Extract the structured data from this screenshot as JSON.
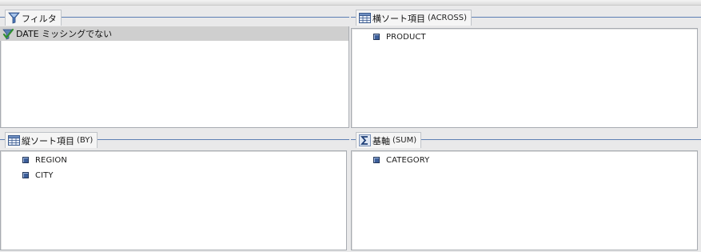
{
  "filter_panel": {
    "title": "フィルタ",
    "items": [
      {
        "label": "DATE ミッシングでない",
        "icon": "check-filter-icon"
      }
    ]
  },
  "across_panel": {
    "title": "横ソート項目",
    "subtitle": "(ACROSS)",
    "items": [
      {
        "label": "PRODUCT"
      }
    ]
  },
  "by_panel": {
    "title": "縦ソート項目",
    "subtitle": "(BY)",
    "items": [
      {
        "label": "REGION"
      },
      {
        "label": "CITY"
      }
    ]
  },
  "sum_panel": {
    "title": "基軸",
    "subtitle": "(SUM)",
    "items": [
      {
        "label": "CATEGORY"
      }
    ]
  },
  "colors": {
    "panel_bg": "#ffffff",
    "window_bg": "#e9e9ea",
    "header_line": "#5d7fb4",
    "selected_row": "#cfcfcf",
    "bullet": "#3d5f9a"
  }
}
